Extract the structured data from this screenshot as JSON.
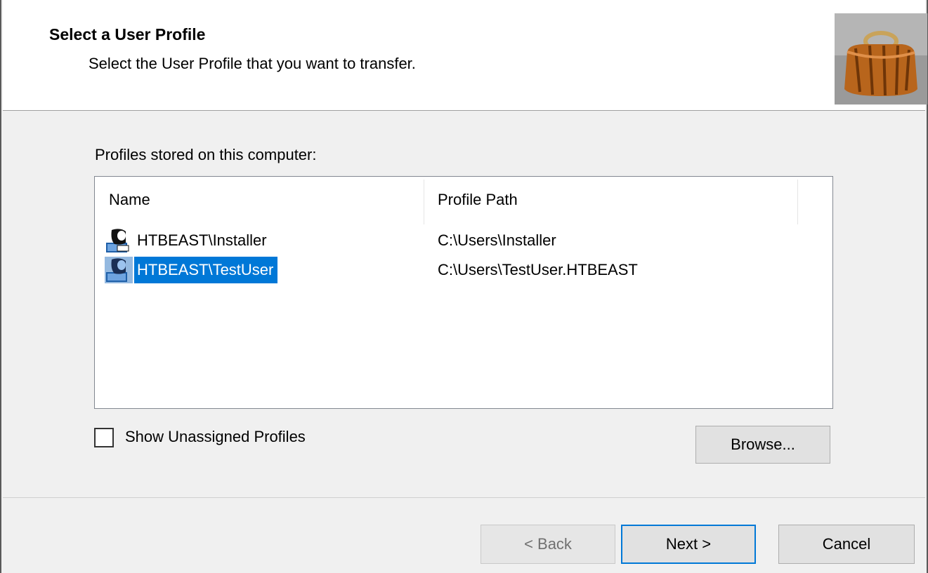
{
  "header": {
    "title": "Select a User Profile",
    "subtitle": "Select the User Profile that you want to transfer."
  },
  "profiles": {
    "label": "Profiles stored on this computer:",
    "columns": [
      "Name",
      "Profile Path"
    ],
    "rows": [
      {
        "name": "HTBEAST\\Installer",
        "path": "C:\\Users\\Installer",
        "selected": false,
        "icon": "user-profile-icon"
      },
      {
        "name": "HTBEAST\\TestUser",
        "path": "C:\\Users\\TestUser.HTBEAST",
        "selected": true,
        "icon": "user-profile-icon"
      }
    ]
  },
  "options": {
    "show_unassigned_label": "Show Unassigned Profiles",
    "show_unassigned_checked": false,
    "browse_label": "Browse..."
  },
  "footer": {
    "back_label": "< Back",
    "next_label": "Next >",
    "cancel_label": "Cancel"
  },
  "colors": {
    "selection": "#0078d7",
    "default_button_border": "#0078d7"
  }
}
